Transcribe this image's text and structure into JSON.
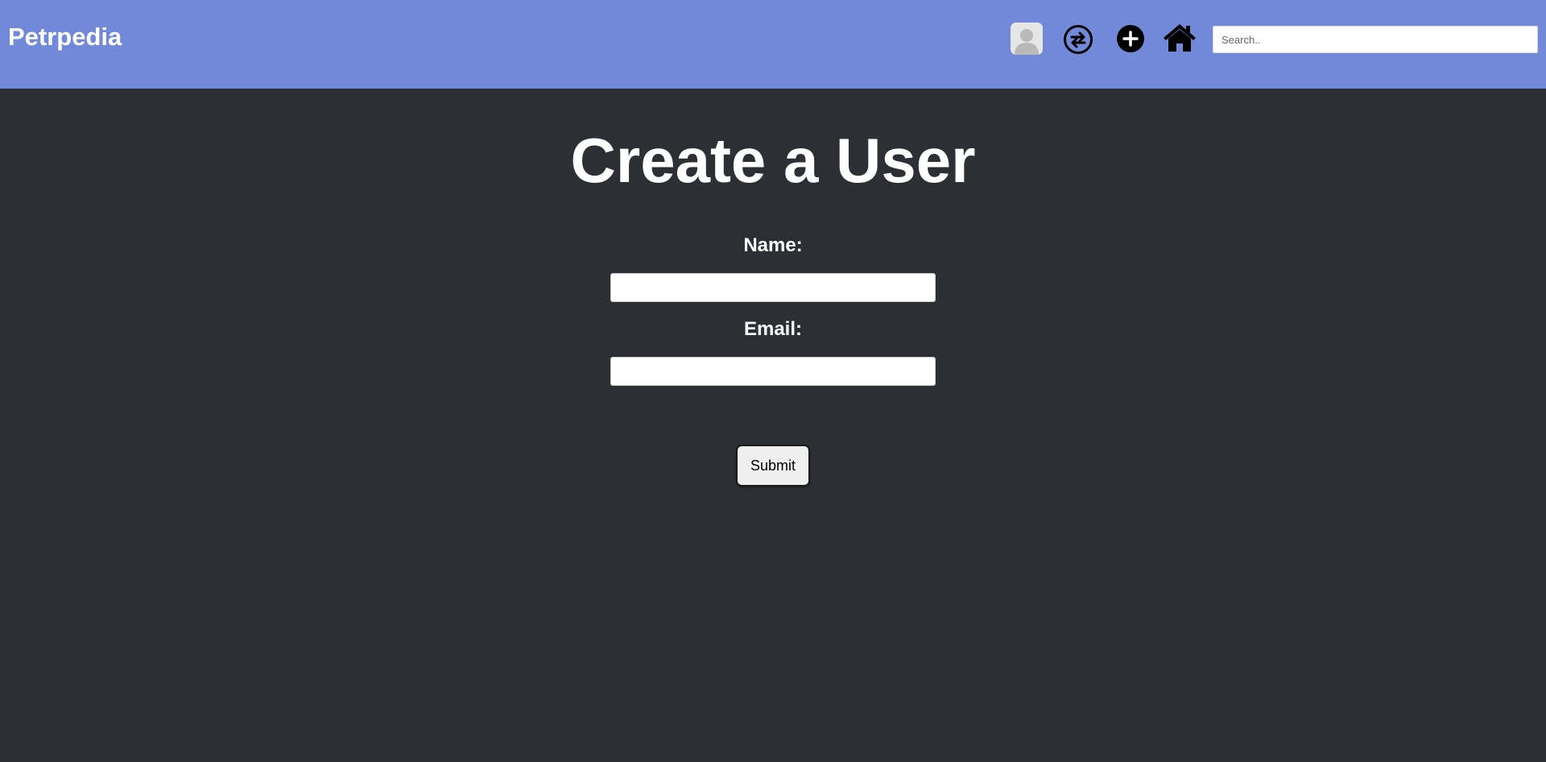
{
  "header": {
    "brand": "Petrpedia",
    "background": "#7289da",
    "icons": [
      "avatar-icon",
      "swap-icon",
      "add-icon",
      "home-icon"
    ],
    "search": {
      "placeholder": "Search..",
      "value": ""
    }
  },
  "main": {
    "title": "Create a User",
    "background": "#2c2f34",
    "form": {
      "name_label": "Name:",
      "name_value": "",
      "email_label": "Email:",
      "email_value": "",
      "submit_label": "Submit"
    }
  }
}
